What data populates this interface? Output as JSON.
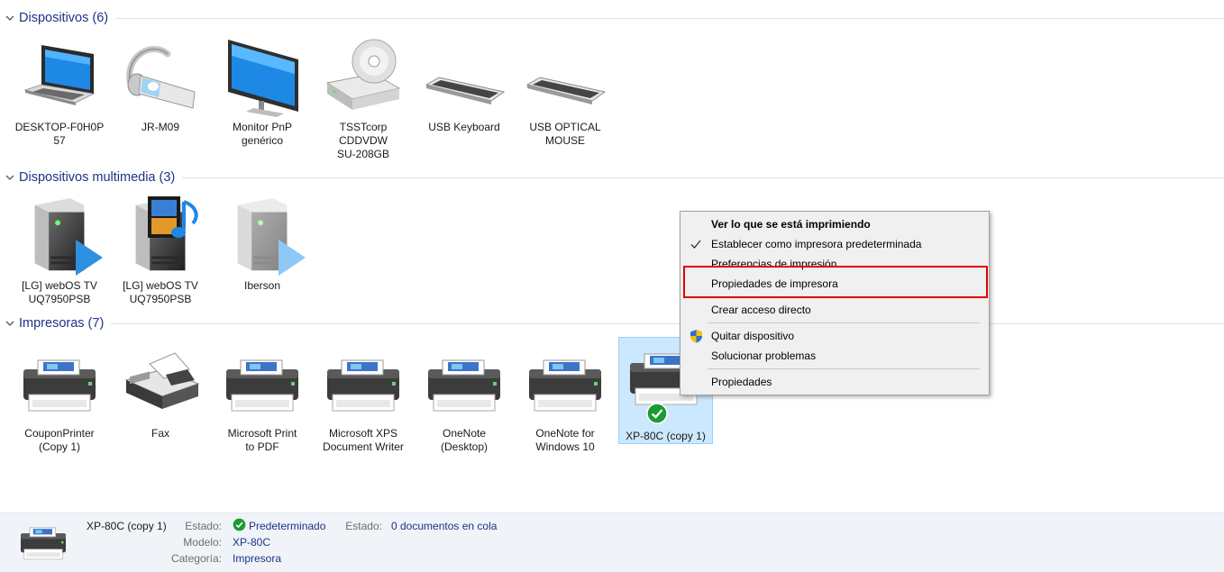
{
  "groups": {
    "devices": {
      "title": "Dispositivos (6)"
    },
    "multimedia": {
      "title": "Dispositivos multimedia (3)"
    },
    "printers": {
      "title": "Impresoras (7)"
    }
  },
  "devices": [
    {
      "line1": "DESKTOP-F0H0P",
      "line2": "57",
      "line3": "",
      "icon": "laptop-icon"
    },
    {
      "line1": "JR-M09",
      "line2": "",
      "line3": "",
      "icon": "headset-icon"
    },
    {
      "line1": "Monitor PnP",
      "line2": "genérico",
      "line3": "",
      "icon": "monitor-icon"
    },
    {
      "line1": "TSSTcorp",
      "line2": "CDDVDW",
      "line3": "SU-208GB",
      "icon": "optical-drive-icon"
    },
    {
      "line1": "USB Keyboard",
      "line2": "",
      "line3": "",
      "icon": "keyboard-icon"
    },
    {
      "line1": "USB OPTICAL",
      "line2": "MOUSE",
      "line3": "",
      "icon": "keyboard-icon"
    }
  ],
  "multimedia": [
    {
      "line1": "[LG] webOS TV",
      "line2": "UQ7950PSB",
      "icon": "media-server-icon"
    },
    {
      "line1": "[LG] webOS TV",
      "line2": "UQ7950PSB",
      "icon": "media-server-music-icon"
    },
    {
      "line1": "Iberson",
      "line2": "",
      "icon": "media-server-icon"
    }
  ],
  "printers": [
    {
      "line1": "CouponPrinter",
      "line2": "(Copy 1)",
      "icon": "printer-icon"
    },
    {
      "line1": "Fax",
      "line2": "",
      "icon": "fax-icon"
    },
    {
      "line1": "Microsoft Print",
      "line2": "to PDF",
      "icon": "printer-icon"
    },
    {
      "line1": "Microsoft XPS",
      "line2": "Document Writer",
      "icon": "printer-icon"
    },
    {
      "line1": "OneNote",
      "line2": "(Desktop)",
      "icon": "printer-icon"
    },
    {
      "line1": "OneNote for",
      "line2": "Windows 10",
      "icon": "printer-icon"
    },
    {
      "line1": "XP-80C (copy 1)",
      "line2": "",
      "icon": "printer-icon"
    }
  ],
  "context_menu": {
    "items": [
      "Ver lo que se está imprimiendo",
      "Establecer como impresora predeterminada",
      "Preferencias de impresión",
      "Propiedades de impresora",
      "Crear acceso directo",
      "Quitar dispositivo",
      "Solucionar problemas",
      "Propiedades"
    ]
  },
  "statusbar": {
    "name": "XP-80C (copy 1)",
    "estado_key": "Estado:",
    "estado_val": "Predeterminado",
    "estado2_key": "Estado:",
    "estado2_val": "0 documentos en cola",
    "modelo_key": "Modelo:",
    "modelo_val": "XP-80C",
    "categoria_key": "Categoría:",
    "categoria_val": "Impresora"
  },
  "colors": {
    "group_title": "#1e3287",
    "selection_bg": "#cce8ff",
    "highlight_border": "#e00000",
    "default_check": "#1a9b33"
  }
}
